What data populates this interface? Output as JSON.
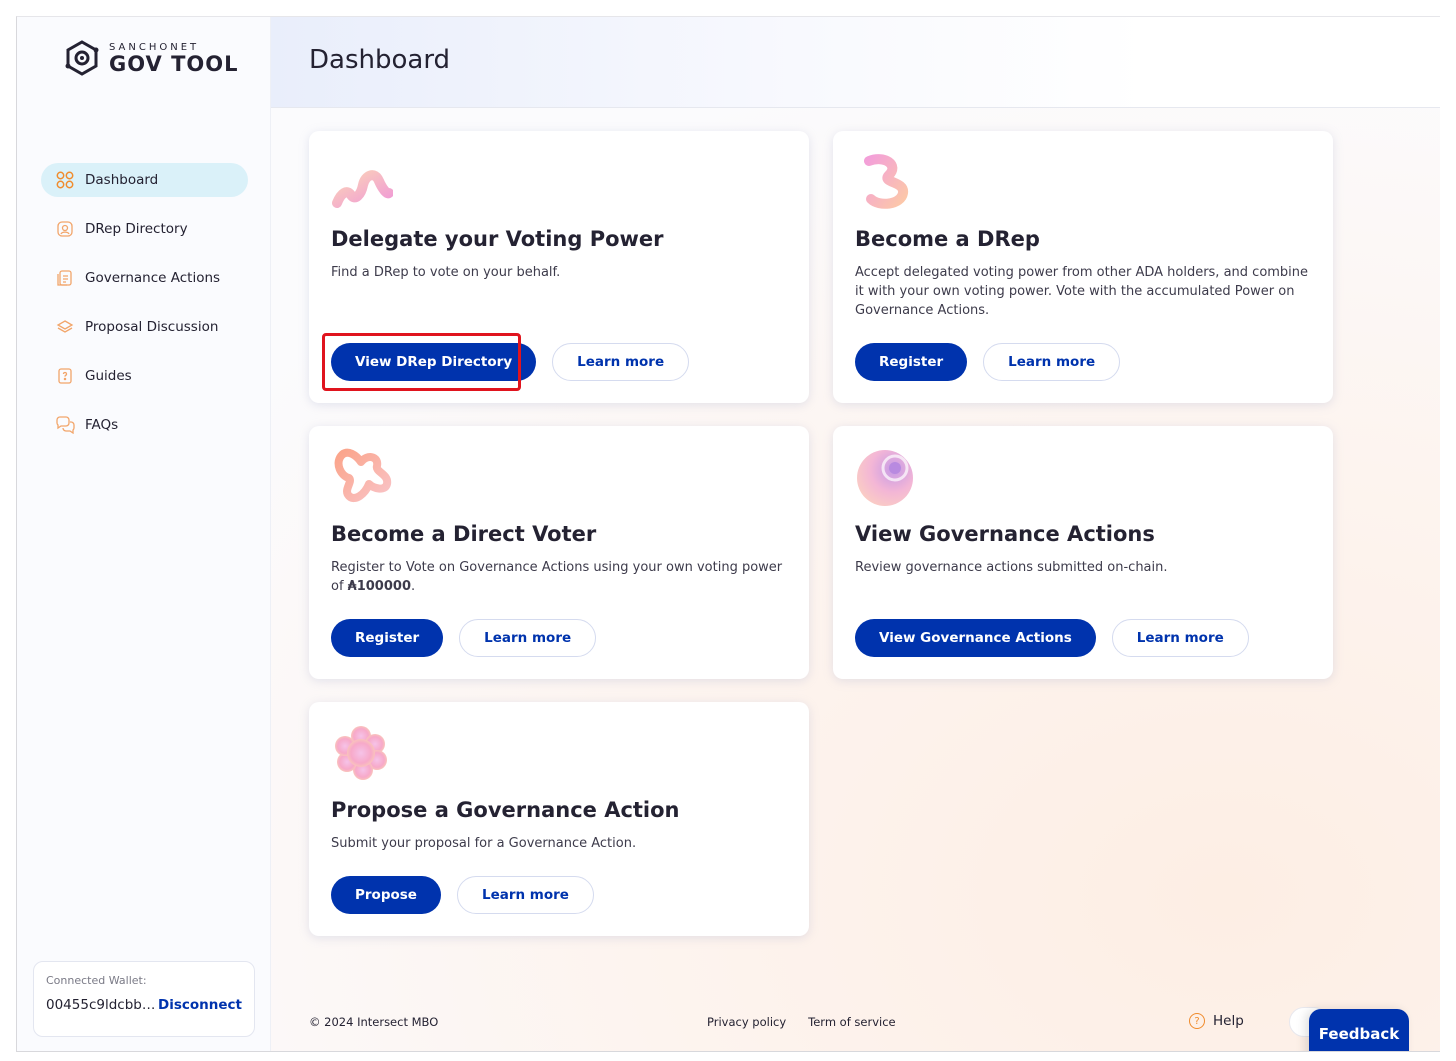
{
  "logo": {
    "top": "SANCHONET",
    "main": "GOV TOOL"
  },
  "sidebar": {
    "items": [
      {
        "label": "Dashboard",
        "icon": "dashboard-grid-icon",
        "active": true
      },
      {
        "label": "DRep Directory",
        "icon": "drep-directory-icon"
      },
      {
        "label": "Governance Actions",
        "icon": "governance-actions-icon"
      },
      {
        "label": "Proposal Discussion",
        "icon": "proposal-discussion-icon"
      },
      {
        "label": "Guides",
        "icon": "guides-icon"
      },
      {
        "label": "FAQs",
        "icon": "faqs-icon"
      }
    ]
  },
  "wallet": {
    "label": "Connected Wallet:",
    "address": "00455c9ldcbb…",
    "disconnect": "Disconnect"
  },
  "header": {
    "title": "Dashboard"
  },
  "cards": [
    {
      "title": "Delegate your Voting Power",
      "description": "Find a DRep to vote on your behalf.",
      "primary": "View DRep Directory",
      "secondary": "Learn more"
    },
    {
      "title": "Become a DRep",
      "description": "Accept delegated voting power from other ADA holders, and combine it with your own voting power. Vote with the accumulated Power on Governance Actions.",
      "primary": "Register",
      "secondary": "Learn more"
    },
    {
      "title": "Become a Direct Voter",
      "description_prefix": "Register to Vote on Governance Actions using your own voting power of ",
      "description_amount": "₳100000",
      "description_suffix": ".",
      "primary": "Register",
      "secondary": "Learn more"
    },
    {
      "title": "View Governance Actions",
      "description": "Review governance actions submitted on-chain.",
      "primary": "View Governance Actions",
      "secondary": "Learn more"
    },
    {
      "title": "Propose a Governance Action",
      "description": "Submit your proposal for a Governance Action.",
      "primary": "Propose",
      "secondary": "Learn more"
    }
  ],
  "footer": {
    "copyright": "© 2024 Intersect MBO",
    "privacy": "Privacy policy",
    "terms": "Term of service",
    "help": "Help",
    "feedback": "Feedback"
  },
  "colors": {
    "primary": "#0033ad",
    "active_nav": "#daf1f9",
    "highlight": "#e0141e",
    "accent": "#f08c2d"
  }
}
